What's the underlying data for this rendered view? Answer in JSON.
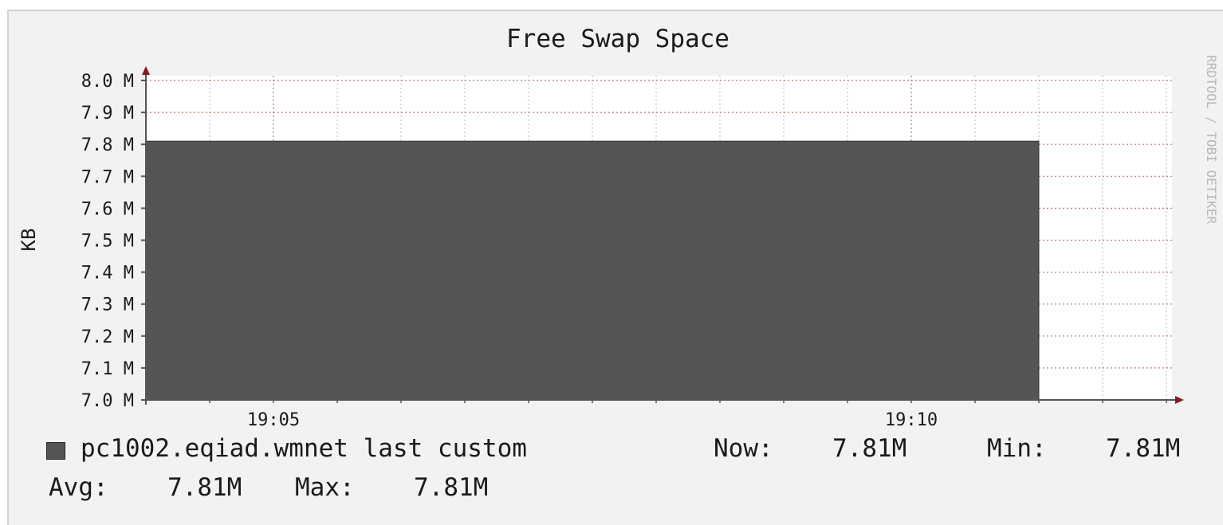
{
  "chart_data": {
    "type": "area",
    "title": "Free Swap Space",
    "ylabel": "KB",
    "xlabel": "",
    "watermark": "RRDTOOL / TOBI OETIKER",
    "ylim": [
      7.0,
      8.0
    ],
    "y_unit": "M",
    "y_ticks": [
      7.0,
      7.1,
      7.2,
      7.3,
      7.4,
      7.5,
      7.6,
      7.7,
      7.8,
      7.9,
      8.0
    ],
    "y_tick_labels": [
      "7.0 M",
      "7.1 M",
      "7.2 M",
      "7.3 M",
      "7.4 M",
      "7.5 M",
      "7.6 M",
      "7.7 M",
      "7.8 M",
      "7.9 M",
      "8.0 M"
    ],
    "x_range": [
      "19:04",
      "19:12"
    ],
    "x_ticks": [
      "19:05",
      "19:10"
    ],
    "grid": true,
    "colors": {
      "area": "#555555",
      "grid_major": "#c87070",
      "grid_minor": "#b9b9b9",
      "axis": "#8b1a1a"
    },
    "series": [
      {
        "name": "pc1002.eqiad.wmnet last custom",
        "points": [
          {
            "x": "19:04",
            "y": 7.81
          },
          {
            "x": "19:11",
            "y": 7.81
          }
        ]
      }
    ],
    "legend": {
      "label": "pc1002.eqiad.wmnet last custom",
      "now_label": "Now:",
      "now_value": "7.81M",
      "min_label": "Min:",
      "min_value": "7.81M",
      "avg_label": "Avg:",
      "avg_value": "7.81M",
      "max_label": "Max:",
      "max_value": "7.81M"
    }
  }
}
